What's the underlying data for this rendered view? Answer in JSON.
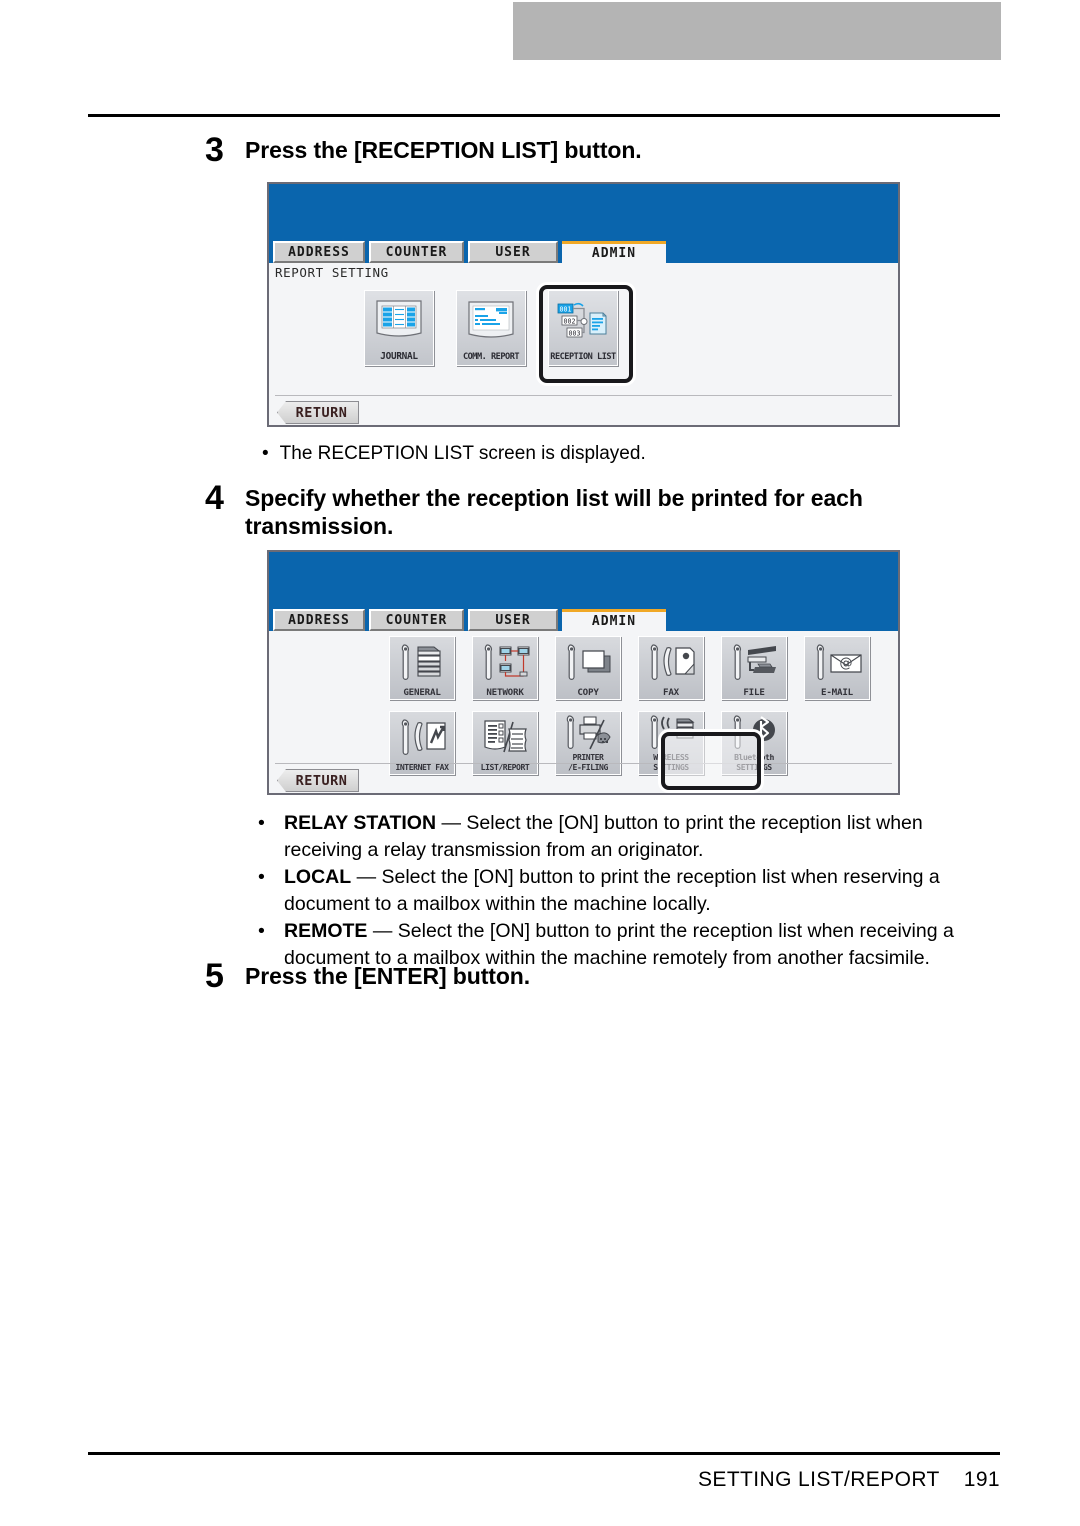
{
  "page": {
    "footer_title": "SETTING LIST/REPORT",
    "page_number": "191"
  },
  "steps": [
    {
      "num": "3",
      "text": "Press the [RECEPTION LIST] button."
    },
    {
      "num": "4",
      "text": "Specify whether the reception list will be printed for each transmission."
    },
    {
      "num": "5",
      "text": "Press the [ENTER] button."
    }
  ],
  "note_after_step3": {
    "dot": "•",
    "text": "The RECEPTION LIST screen is displayed."
  },
  "bullets": [
    {
      "dot": "•",
      "term": "RELAY STATION",
      "dash": " — ",
      "text": "Select the [ON] button to print the reception list when receiving a relay transmission from an originator."
    },
    {
      "dot": "•",
      "term": "LOCAL",
      "dash": " — ",
      "text": "Select the [ON] button to print the reception list when reserving a document to a mailbox within the machine locally."
    },
    {
      "dot": "•",
      "term": "REMOTE",
      "dash": " — ",
      "text": "Select the [ON] button to print the reception list when receiving a document to a mailbox within the machine remotely from another facsimile."
    }
  ],
  "panel1": {
    "tabs": [
      {
        "label": "ADDRESS",
        "active": false
      },
      {
        "label": "COUNTER",
        "active": false
      },
      {
        "label": "USER",
        "active": false
      },
      {
        "label": "ADMIN",
        "active": true
      }
    ],
    "breadcrumb": "REPORT SETTING",
    "return_label": "RETURN",
    "buttons": [
      {
        "label": "JOURNAL",
        "icon": "journal-table-icon",
        "selected": false
      },
      {
        "label": "COMM. REPORT",
        "icon": "comm-report-page-icon",
        "selected": false
      },
      {
        "label": "RECEPTION LIST",
        "icon": "reception-list-routing-icon",
        "selected": true
      }
    ]
  },
  "panel2": {
    "tabs": [
      {
        "label": "ADDRESS",
        "active": false
      },
      {
        "label": "COUNTER",
        "active": false
      },
      {
        "label": "USER",
        "active": false
      },
      {
        "label": "ADMIN",
        "active": true
      }
    ],
    "return_label": "RETURN",
    "row1": [
      {
        "label": "GENERAL",
        "icon": "wrench-copier-icon"
      },
      {
        "label": "NETWORK",
        "icon": "wrench-network-icon"
      },
      {
        "label": "COPY",
        "icon": "wrench-paper-icon"
      },
      {
        "label": "FAX",
        "icon": "wrench-fax-icon"
      },
      {
        "label": "FILE",
        "icon": "wrench-folder-icon"
      },
      {
        "label": "E-MAIL",
        "icon": "wrench-envelope-at-icon"
      }
    ],
    "row2": [
      {
        "label": "INTERNET FAX",
        "icon": "wrench-internet-fax-icon"
      },
      {
        "label": "LIST/REPORT",
        "icon": "list-report-icon"
      },
      {
        "label": "PRINTER\n/E-FILING",
        "icon": "wrench-printer-efiling-icon"
      },
      {
        "label": "WIRELESS\nSETTINGS",
        "icon": "wrench-wireless-icon"
      },
      {
        "label": "Bluetooth\nSETTINGS",
        "icon": "wrench-bluetooth-icon"
      }
    ]
  },
  "colors": {
    "panel_blue": "#0a65ad",
    "active_tab_accent": "#f0a826",
    "top_band_gray": "#b4b4b4",
    "button_face": "#d0d0d0"
  }
}
